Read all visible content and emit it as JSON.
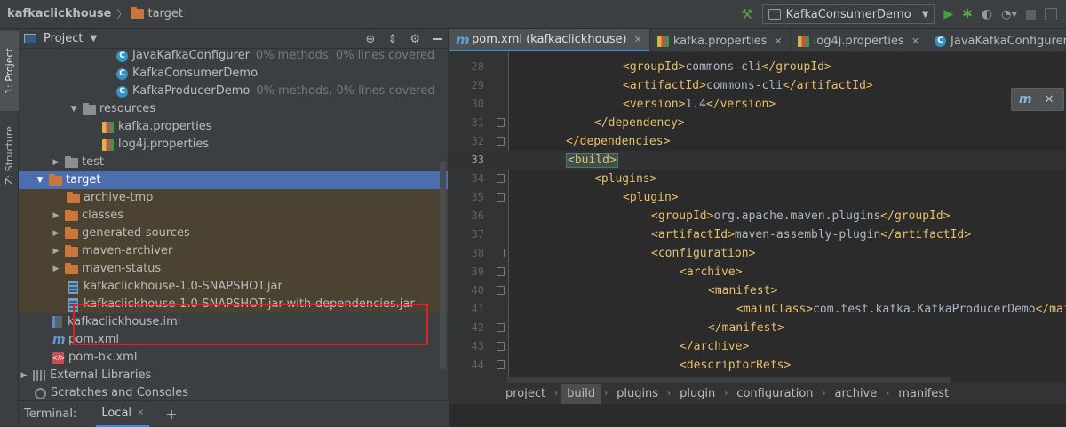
{
  "breadcrumb": {
    "project": "kafkaclickhouse",
    "folder": "target"
  },
  "run_config": {
    "name": "KafkaConsumerDemo"
  },
  "left_strip": {
    "project_tab": "1: Project",
    "structure_tab": "Z: Structure"
  },
  "project_panel": {
    "title": "Project"
  },
  "tree": [
    {
      "label": "JavaKafkaConfigurer",
      "coverage": "0% methods, 0% lines covered",
      "icon": "class-icon"
    },
    {
      "label": "KafkaConsumerDemo",
      "coverage": "",
      "icon": "class-icon"
    },
    {
      "label": "KafkaProducerDemo",
      "coverage": "0% methods, 0% lines covered",
      "icon": "class-icon"
    },
    {
      "label": "resources",
      "icon": "resources-folder-icon"
    },
    {
      "label": "kafka.properties",
      "icon": "properties-file-icon"
    },
    {
      "label": "log4j.properties",
      "icon": "properties-file-icon"
    },
    {
      "label": "test",
      "icon": "folder-icon"
    },
    {
      "label": "target",
      "icon": "folder-icon"
    },
    {
      "label": "archive-tmp",
      "icon": "folder-icon"
    },
    {
      "label": "classes",
      "icon": "folder-icon"
    },
    {
      "label": "generated-sources",
      "icon": "folder-icon"
    },
    {
      "label": "maven-archiver",
      "icon": "folder-icon"
    },
    {
      "label": "maven-status",
      "icon": "folder-icon"
    },
    {
      "label": "kafkaclickhouse-1.0-SNAPSHOT.jar",
      "icon": "jar-icon"
    },
    {
      "label": "kafkaclickhouse-1.0-SNAPSHOT-jar-with-dependencies.jar",
      "icon": "jar-icon"
    },
    {
      "label": "kafkaclickhouse.iml",
      "icon": "iml-file-icon"
    },
    {
      "label": "pom.xml",
      "icon": "maven-icon"
    },
    {
      "label": "pom-bk.xml",
      "icon": "xml-file-icon"
    },
    {
      "label": "External Libraries",
      "icon": "library-icon"
    },
    {
      "label": "Scratches and Consoles",
      "icon": "scratch-icon"
    }
  ],
  "terminal": {
    "label": "Terminal:",
    "tab": "Local",
    "add": "+"
  },
  "editor_tabs": [
    {
      "label": "pom.xml (kafkaclickhouse)",
      "icon": "maven-icon"
    },
    {
      "label": "kafka.properties",
      "icon": "properties-file-icon"
    },
    {
      "label": "log4j.properties",
      "icon": "properties-file-icon"
    },
    {
      "label": "JavaKafkaConfigurer.java",
      "icon": "class-icon"
    }
  ],
  "code_lines": [
    {
      "num": "28",
      "indent": 16,
      "open": "<groupId>",
      "text": "commons-cli",
      "close": "</groupId>"
    },
    {
      "num": "29",
      "indent": 16,
      "open": "<artifactId>",
      "text": "commons-cli",
      "close": "</artifactId>"
    },
    {
      "num": "30",
      "indent": 16,
      "open": "<version>",
      "text": "1.4",
      "close": "</version>"
    },
    {
      "num": "31",
      "indent": 12,
      "open": "</dependency>",
      "text": "",
      "close": ""
    },
    {
      "num": "32",
      "indent": 8,
      "open": "</dependencies>",
      "text": "",
      "close": ""
    },
    {
      "num": "33",
      "indent": 8,
      "open": "<build>",
      "text": "",
      "close": ""
    },
    {
      "num": "34",
      "indent": 12,
      "open": "<plugins>",
      "text": "",
      "close": ""
    },
    {
      "num": "35",
      "indent": 16,
      "open": "<plugin>",
      "text": "",
      "close": ""
    },
    {
      "num": "36",
      "indent": 20,
      "open": "<groupId>",
      "text": "org.apache.maven.plugins",
      "close": "</groupId>"
    },
    {
      "num": "37",
      "indent": 20,
      "open": "<artifactId>",
      "text": "maven-assembly-plugin",
      "close": "</artifactId>"
    },
    {
      "num": "38",
      "indent": 20,
      "open": "<configuration>",
      "text": "",
      "close": ""
    },
    {
      "num": "39",
      "indent": 24,
      "open": "<archive>",
      "text": "",
      "close": ""
    },
    {
      "num": "40",
      "indent": 28,
      "open": "<manifest>",
      "text": "",
      "close": ""
    },
    {
      "num": "41",
      "indent": 32,
      "open": "<mainClass>",
      "text": "com.test.kafka.KafkaProducerDemo",
      "close": "</mainCla"
    },
    {
      "num": "42",
      "indent": 28,
      "open": "</manifest>",
      "text": "",
      "close": ""
    },
    {
      "num": "43",
      "indent": 24,
      "open": "</archive>",
      "text": "",
      "close": ""
    },
    {
      "num": "44",
      "indent": 24,
      "open": "<descriptorRefs>",
      "text": "",
      "close": ""
    }
  ],
  "editor_breadcrumbs": [
    "project",
    "build",
    "plugins",
    "plugin",
    "configuration",
    "archive",
    "manifest"
  ],
  "colors": {
    "selection": "#4b6eaf",
    "excluded_bg": "#4b4231",
    "highlight_box": "#d8242b",
    "xml_tag": "#e8bf6a",
    "xml_text": "#a9b7c6"
  }
}
